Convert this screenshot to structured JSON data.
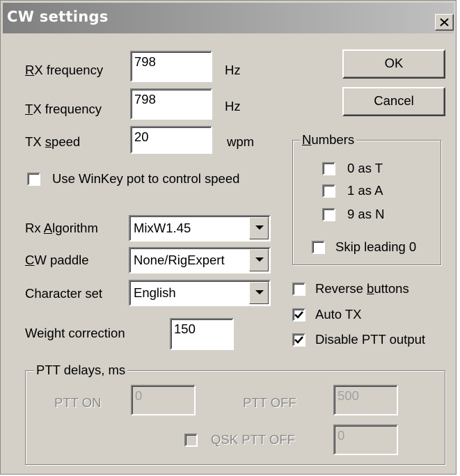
{
  "window": {
    "title": "CW settings"
  },
  "rx_frequency": {
    "label_key": "R",
    "label_rest": "X frequency",
    "value": "798",
    "unit": "Hz"
  },
  "tx_frequency": {
    "label_key": "T",
    "label_rest": "X frequency",
    "value": "798",
    "unit": "Hz"
  },
  "tx_speed": {
    "label_pre": "TX ",
    "label_key": "s",
    "label_rest": "peed",
    "value": "20",
    "unit": "wpm"
  },
  "winkey": {
    "label": "Use WinKey pot to control speed",
    "checked": false
  },
  "rx_algorithm": {
    "label_pre": "Rx ",
    "label_key": "A",
    "label_rest": "lgorithm",
    "value": "MixW1.45"
  },
  "cw_paddle": {
    "label_key": "C",
    "label_rest": "W paddle",
    "value": "None/RigExpert"
  },
  "character_set": {
    "label": "Character set",
    "value": "English"
  },
  "weight_correction": {
    "label": "Weight correction",
    "value": "150"
  },
  "buttons": {
    "ok": "OK",
    "cancel": "Cancel"
  },
  "numbers": {
    "legend_key": "N",
    "legend_rest": "umbers",
    "items": [
      {
        "label": "0 as T",
        "checked": false
      },
      {
        "label": "1 as A",
        "checked": false
      },
      {
        "label": "9 as N",
        "checked": false
      }
    ],
    "skip_leading": {
      "label": "Skip leading 0",
      "checked": false
    }
  },
  "options": {
    "reverse": {
      "label_pre": "Reverse ",
      "label_key": "b",
      "label_rest": "uttons",
      "checked": false
    },
    "auto_tx": {
      "label": "Auto TX",
      "checked": true
    },
    "disable_ptt": {
      "label": "Disable PTT output",
      "checked": true
    }
  },
  "ptt": {
    "legend": "PTT delays, ms",
    "on_label": "PTT ON",
    "on_value": "0",
    "off_label": "PTT OFF",
    "off_value": "500",
    "qsk_label": "QSK PTT OFF",
    "qsk_value": "0",
    "qsk_checked": false
  }
}
